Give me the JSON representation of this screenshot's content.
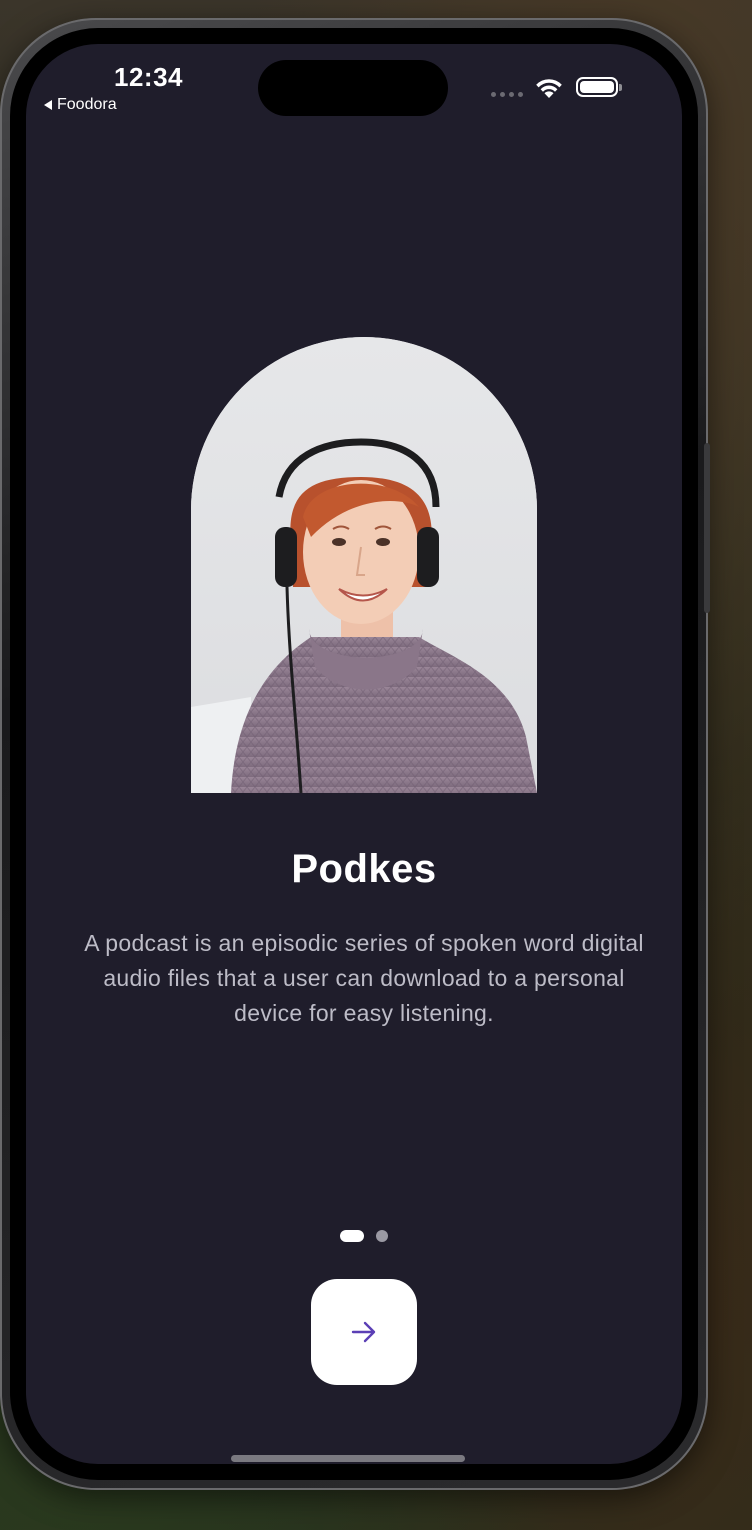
{
  "status_bar": {
    "time": "12:34",
    "back_app": "Foodora"
  },
  "onboarding": {
    "title": "Podkes",
    "description": "A podcast is an episodic series of spoken word digital audio files that a user can download to a personal device for easy listening.",
    "page_count": 2,
    "current_page": 1,
    "next_icon": "arrow-right-icon",
    "hero_image": "woman-with-headphones-photo"
  },
  "colors": {
    "background": "#1f1d2b",
    "accent": "#5b3fb5",
    "button": "#ffffff"
  }
}
